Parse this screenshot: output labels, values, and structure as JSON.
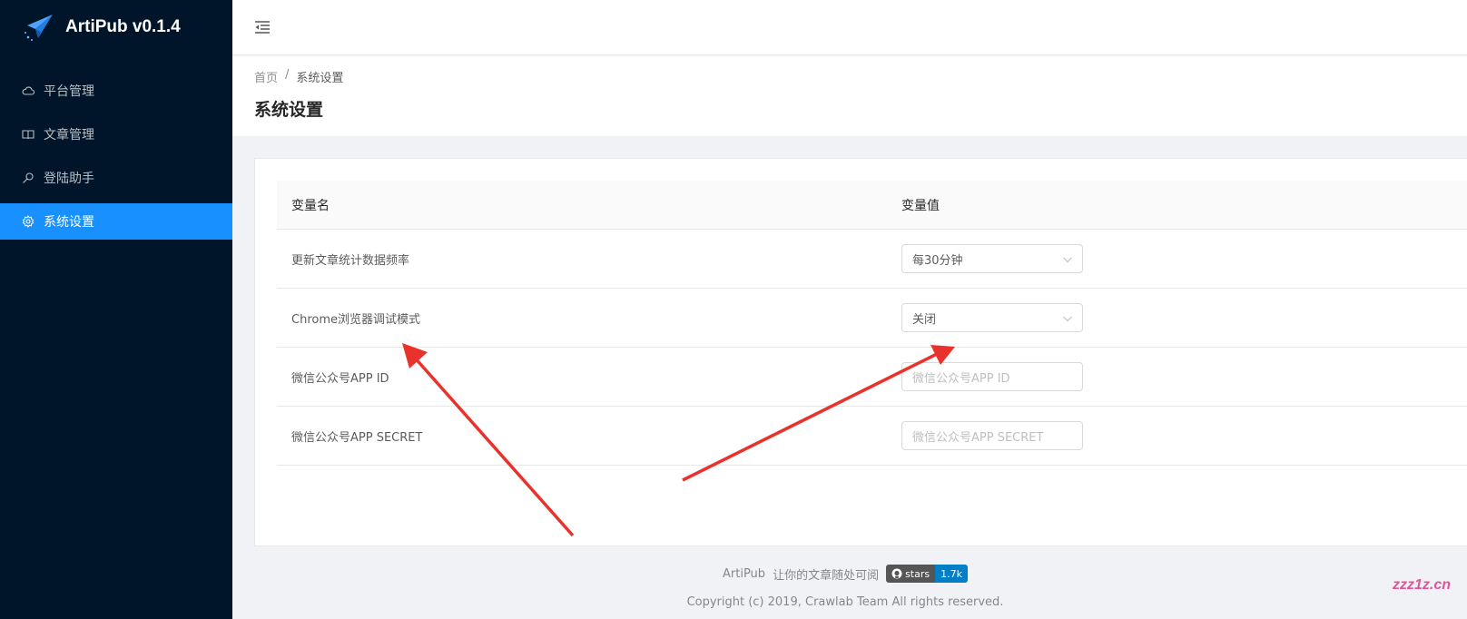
{
  "app": {
    "title": "ArtiPub v0.1.4"
  },
  "sidebar": {
    "items": [
      {
        "label": "平台管理",
        "icon": "cloud-icon"
      },
      {
        "label": "文章管理",
        "icon": "book-icon"
      },
      {
        "label": "登陆助手",
        "icon": "key-icon"
      },
      {
        "label": "系统设置",
        "icon": "gear-icon",
        "active": true
      }
    ]
  },
  "breadcrumb": {
    "home": "首页",
    "separator": "/",
    "current": "系统设置"
  },
  "page": {
    "title": "系统设置"
  },
  "table": {
    "headers": {
      "name": "变量名",
      "value": "变量值"
    },
    "rows": [
      {
        "name": "更新文章统计数据频率",
        "type": "select",
        "value": "每30分钟"
      },
      {
        "name": "Chrome浏览器调试模式",
        "type": "select",
        "value": "关闭"
      },
      {
        "name": "微信公众号APP ID",
        "type": "input",
        "placeholder": "微信公众号APP ID"
      },
      {
        "name": "微信公众号APP SECRET",
        "type": "input",
        "placeholder": "微信公众号APP SECRET"
      }
    ]
  },
  "footer": {
    "brand": "ArtiPub",
    "slogan": "让你的文章随处可阅",
    "badge_left": "stars",
    "badge_right": "1.7k",
    "copyright": "Copyright (c) 2019, Crawlab Team All rights reserved."
  },
  "watermark": "zzz1z.cn",
  "colors": {
    "sider": "#001529",
    "accent": "#1890ff",
    "arrow": "#e8322b"
  }
}
